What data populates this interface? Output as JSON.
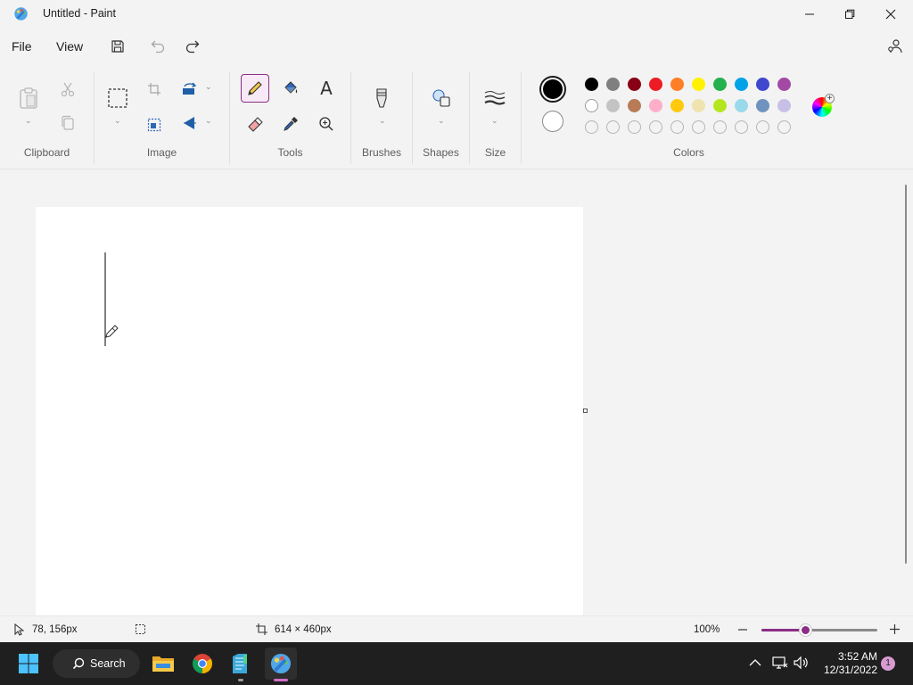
{
  "window": {
    "title": "Untitled - Paint"
  },
  "menu": {
    "file": "File",
    "view": "View"
  },
  "ribbon": {
    "groups": {
      "clipboard": "Clipboard",
      "image": "Image",
      "tools": "Tools",
      "brushes": "Brushes",
      "shapes": "Shapes",
      "size": "Size",
      "colors": "Colors"
    },
    "text_tool": "A",
    "colors": {
      "primary": "#000000",
      "secondary": "#ffffff",
      "row1": [
        "#000000",
        "#7f7f7f",
        "#880015",
        "#ed1c24",
        "#ff7f27",
        "#fff200",
        "#22b14c",
        "#00a2e8",
        "#3f48cc",
        "#a349a4"
      ],
      "row2": [
        "#ffffff",
        "#c3c3c3",
        "#b97a57",
        "#ffaec9",
        "#ffc90e",
        "#efe4b0",
        "#b5e61d",
        "#99d9ea",
        "#7092be",
        "#c8bfe7"
      ],
      "row3_empty_count": 10
    }
  },
  "status": {
    "cursor_position": "78, 156px",
    "canvas_size": "614 × 460px",
    "zoom": "100%",
    "zoom_level": 0.38
  },
  "taskbar": {
    "search_label": "Search",
    "time": "3:52 AM",
    "date": "12/31/2022",
    "notification_count": "1"
  }
}
